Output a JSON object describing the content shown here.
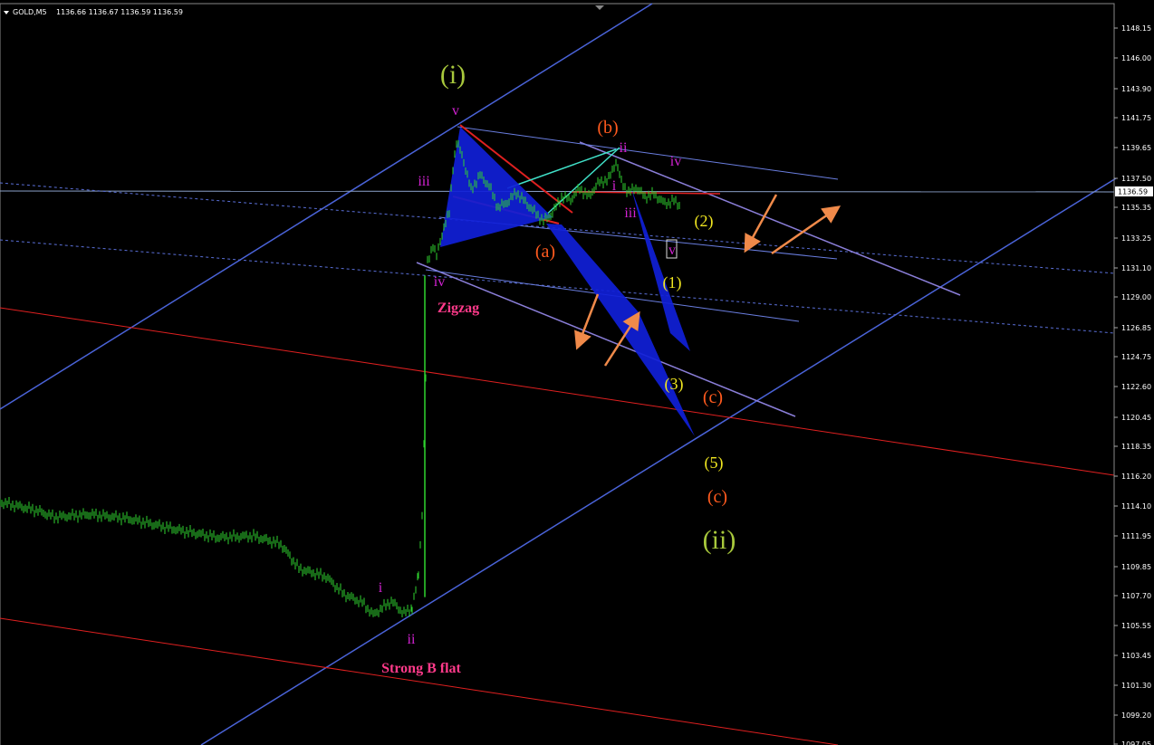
{
  "header": {
    "symbol_timeframe": "GOLD,M5",
    "prices": "1136.66 1136.67 1136.59 1136.59"
  },
  "colors": {
    "background": "#000000",
    "candles": "#2fd52f",
    "channel": "#4a63d8",
    "trendline_red": "#e02020",
    "wedge_fill": "#1020d8",
    "label_magenta": "#d422d4",
    "label_orange": "#ff5a1e",
    "label_yellow": "#f0e620",
    "label_olive": "#a8c83c",
    "label_pink": "#ff3a8a",
    "arrow": "#f08a4a",
    "current_price_box": "#ffffff"
  },
  "chart_data": {
    "type": "candlestick",
    "instrument": "GOLD",
    "timeframe": "M5",
    "current_price": "1136.59",
    "y_ticks": [
      "1148.15",
      "1146.00",
      "1143.90",
      "1141.75",
      "1139.65",
      "1137.50",
      "1135.35",
      "1133.25",
      "1131.10",
      "1129.00",
      "1126.85",
      "1124.75",
      "1122.60",
      "1120.45",
      "1118.35",
      "1116.20",
      "1114.10",
      "1111.95",
      "1109.85",
      "1107.70",
      "1105.55",
      "1103.45",
      "1101.30",
      "1099.20",
      "1097.05"
    ],
    "ylim": [
      1096.9,
      1149.8
    ],
    "price_path": [
      [
        0,
        1114.8
      ],
      [
        40,
        1114.2
      ],
      [
        60,
        1113.7
      ],
      [
        100,
        1113.9
      ],
      [
        140,
        1113.6
      ],
      [
        180,
        1113.0
      ],
      [
        200,
        1112.7
      ],
      [
        240,
        1112.2
      ],
      [
        280,
        1112.3
      ],
      [
        310,
        1111.7
      ],
      [
        330,
        1109.9
      ],
      [
        360,
        1109.3
      ],
      [
        380,
        1108.0
      ],
      [
        400,
        1107.4
      ],
      [
        412,
        1106.5
      ],
      [
        420,
        1106.9
      ],
      [
        432,
        1107.5
      ],
      [
        446,
        1106.6
      ],
      [
        455,
        1107.0
      ],
      [
        462,
        1109.4
      ],
      [
        466,
        1114.0
      ],
      [
        470,
        1124.0
      ],
      [
        472,
        1132.4
      ],
      [
        478,
        1133.8
      ],
      [
        482,
        1132.9
      ],
      [
        490,
        1135.1
      ],
      [
        496,
        1136.1
      ],
      [
        500,
        1139.5
      ],
      [
        504,
        1141.3
      ],
      [
        510,
        1140.4
      ],
      [
        520,
        1137.8
      ],
      [
        530,
        1138.9
      ],
      [
        540,
        1138.1
      ],
      [
        550,
        1136.5
      ],
      [
        560,
        1136.9
      ],
      [
        570,
        1137.6
      ],
      [
        580,
        1136.9
      ],
      [
        590,
        1136.2
      ],
      [
        600,
        1135.5
      ],
      [
        610,
        1136.1
      ],
      [
        620,
        1137.3
      ],
      [
        630,
        1137.1
      ],
      [
        640,
        1137.9
      ],
      [
        650,
        1137.3
      ],
      [
        660,
        1138.3
      ],
      [
        672,
        1138.6
      ],
      [
        680,
        1139.9
      ],
      [
        686,
        1138.4
      ],
      [
        694,
        1137.6
      ],
      [
        702,
        1138.0
      ],
      [
        712,
        1137.3
      ],
      [
        722,
        1137.5
      ],
      [
        734,
        1136.8
      ],
      [
        744,
        1137.0
      ],
      [
        752,
        1136.6
      ]
    ],
    "annotations": [
      {
        "text": "(i)",
        "color": "olive"
      },
      {
        "text": "v",
        "color": "magenta"
      },
      {
        "text": "iii",
        "color": "magenta"
      },
      {
        "text": "iv",
        "color": "magenta"
      },
      {
        "text": "Zigzag",
        "color": "pink"
      },
      {
        "text": "(b)",
        "color": "orange"
      },
      {
        "text": "ii",
        "color": "magenta"
      },
      {
        "text": "i",
        "color": "magenta"
      },
      {
        "text": "iv",
        "color": "magenta"
      },
      {
        "text": "iii",
        "color": "magenta"
      },
      {
        "text": "(2)",
        "color": "yellow"
      },
      {
        "text": "v",
        "color": "magenta"
      },
      {
        "text": "(a)",
        "color": "orange"
      },
      {
        "text": "(1)",
        "color": "yellow"
      },
      {
        "text": "(3)",
        "color": "yellow"
      },
      {
        "text": "(c)",
        "color": "orange"
      },
      {
        "text": "(5)",
        "color": "yellow"
      },
      {
        "text": "(c)",
        "color": "orange"
      },
      {
        "text": "(ii)",
        "color": "olive"
      },
      {
        "text": "i",
        "color": "magenta"
      },
      {
        "text": "ii",
        "color": "magenta"
      },
      {
        "text": "Strong B flat",
        "color": "pink"
      }
    ]
  }
}
